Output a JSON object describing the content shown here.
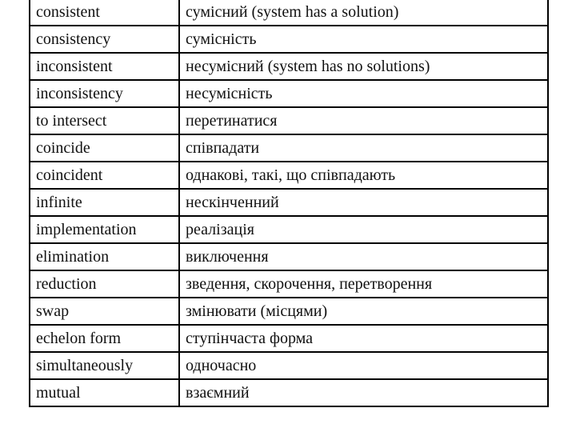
{
  "glossary": {
    "rows": [
      {
        "term": "consistent",
        "translation": "сумісний (system has a solution)"
      },
      {
        "term": "consistency",
        "translation": "сумісність"
      },
      {
        "term": "inconsistent",
        "translation": "несумісний (system has no solutions)"
      },
      {
        "term": "inconsistency",
        "translation": "несумісність"
      },
      {
        "term": "to intersect",
        "translation": "перетинатися"
      },
      {
        "term": "coincide",
        "translation": "співпадати"
      },
      {
        "term": "coincident",
        "translation": "однакові, такі, що співпадають"
      },
      {
        "term": "infinite",
        "translation": "нескінченний"
      },
      {
        "term": "implementation",
        "translation": "реалізація"
      },
      {
        "term": "elimination",
        "translation": "виключення"
      },
      {
        "term": "reduction",
        "translation": "зведення, скорочення, перетворення"
      },
      {
        "term": "swap",
        "translation": "змінювати (місцями)"
      },
      {
        "term": "echelon form",
        "translation": "ступінчаста форма"
      },
      {
        "term": "simultaneously",
        "translation": "одночасно"
      },
      {
        "term": "mutual",
        "translation": "взаємний"
      }
    ]
  }
}
